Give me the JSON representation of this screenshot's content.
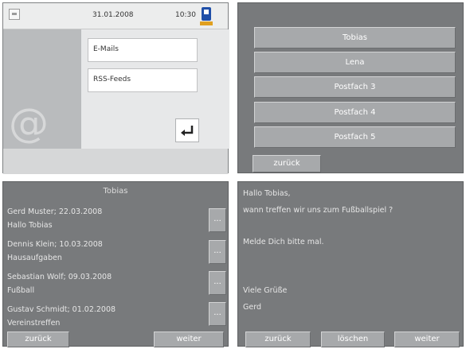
{
  "home": {
    "date": "31.01.2008",
    "time": "10:30",
    "buttons": [
      "E-Mails",
      "RSS-Feeds"
    ]
  },
  "mailboxes": {
    "items": [
      "Tobias",
      "Lena",
      "Postfach 3",
      "Postfach 4",
      "Postfach 5"
    ],
    "back_label": "zurück"
  },
  "inbox": {
    "title": "Tobias",
    "messages": [
      {
        "sender": "Gerd Muster; 22.03.2008",
        "subject": "Hallo Tobias"
      },
      {
        "sender": "Dennis Klein; 10.03.2008",
        "subject": "Hausaufgaben"
      },
      {
        "sender": "Sebastian Wolf; 09.03.2008",
        "subject": "Fußball"
      },
      {
        "sender": "Gustav Schmidt; 01.02.2008",
        "subject": "Vereinstreffen"
      }
    ],
    "more_label": "...",
    "back_label": "zurück",
    "next_label": "weiter"
  },
  "message": {
    "lines": [
      "Hallo Tobias,",
      "wann treffen wir uns zum Fußballspiel ?",
      "Melde Dich bitte mal.",
      "Viele Grüße",
      "Gerd"
    ],
    "back_label": "zurück",
    "delete_label": "löschen",
    "next_label": "weiter"
  },
  "colors": {
    "battery": "#1f4fa8",
    "panel_dark": "#787a7c",
    "button": "#a7a9ab"
  },
  "icons": [
    "settings-icon",
    "battery-icon",
    "at-sign-icon",
    "enter-icon"
  ]
}
